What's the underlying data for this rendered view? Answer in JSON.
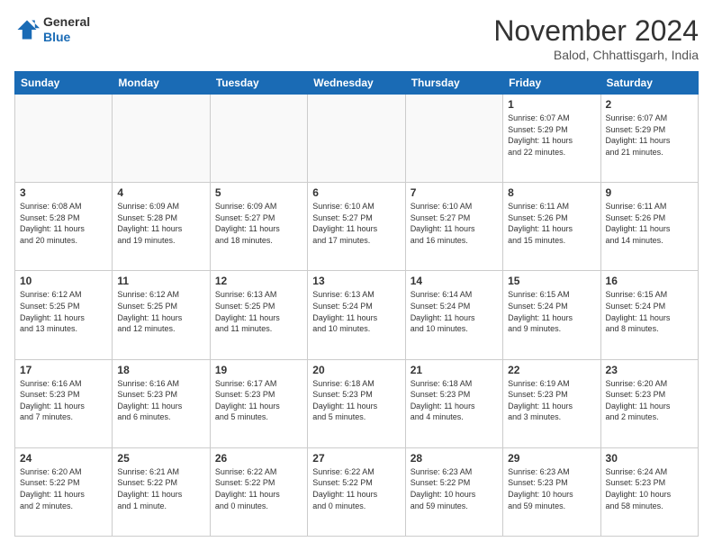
{
  "header": {
    "logo_line1": "General",
    "logo_line2": "Blue",
    "month": "November 2024",
    "location": "Balod, Chhattisgarh, India"
  },
  "days_of_week": [
    "Sunday",
    "Monday",
    "Tuesday",
    "Wednesday",
    "Thursday",
    "Friday",
    "Saturday"
  ],
  "weeks": [
    [
      {
        "day": "",
        "info": ""
      },
      {
        "day": "",
        "info": ""
      },
      {
        "day": "",
        "info": ""
      },
      {
        "day": "",
        "info": ""
      },
      {
        "day": "",
        "info": ""
      },
      {
        "day": "1",
        "info": "Sunrise: 6:07 AM\nSunset: 5:29 PM\nDaylight: 11 hours\nand 22 minutes."
      },
      {
        "day": "2",
        "info": "Sunrise: 6:07 AM\nSunset: 5:29 PM\nDaylight: 11 hours\nand 21 minutes."
      }
    ],
    [
      {
        "day": "3",
        "info": "Sunrise: 6:08 AM\nSunset: 5:28 PM\nDaylight: 11 hours\nand 20 minutes."
      },
      {
        "day": "4",
        "info": "Sunrise: 6:09 AM\nSunset: 5:28 PM\nDaylight: 11 hours\nand 19 minutes."
      },
      {
        "day": "5",
        "info": "Sunrise: 6:09 AM\nSunset: 5:27 PM\nDaylight: 11 hours\nand 18 minutes."
      },
      {
        "day": "6",
        "info": "Sunrise: 6:10 AM\nSunset: 5:27 PM\nDaylight: 11 hours\nand 17 minutes."
      },
      {
        "day": "7",
        "info": "Sunrise: 6:10 AM\nSunset: 5:27 PM\nDaylight: 11 hours\nand 16 minutes."
      },
      {
        "day": "8",
        "info": "Sunrise: 6:11 AM\nSunset: 5:26 PM\nDaylight: 11 hours\nand 15 minutes."
      },
      {
        "day": "9",
        "info": "Sunrise: 6:11 AM\nSunset: 5:26 PM\nDaylight: 11 hours\nand 14 minutes."
      }
    ],
    [
      {
        "day": "10",
        "info": "Sunrise: 6:12 AM\nSunset: 5:25 PM\nDaylight: 11 hours\nand 13 minutes."
      },
      {
        "day": "11",
        "info": "Sunrise: 6:12 AM\nSunset: 5:25 PM\nDaylight: 11 hours\nand 12 minutes."
      },
      {
        "day": "12",
        "info": "Sunrise: 6:13 AM\nSunset: 5:25 PM\nDaylight: 11 hours\nand 11 minutes."
      },
      {
        "day": "13",
        "info": "Sunrise: 6:13 AM\nSunset: 5:24 PM\nDaylight: 11 hours\nand 10 minutes."
      },
      {
        "day": "14",
        "info": "Sunrise: 6:14 AM\nSunset: 5:24 PM\nDaylight: 11 hours\nand 10 minutes."
      },
      {
        "day": "15",
        "info": "Sunrise: 6:15 AM\nSunset: 5:24 PM\nDaylight: 11 hours\nand 9 minutes."
      },
      {
        "day": "16",
        "info": "Sunrise: 6:15 AM\nSunset: 5:24 PM\nDaylight: 11 hours\nand 8 minutes."
      }
    ],
    [
      {
        "day": "17",
        "info": "Sunrise: 6:16 AM\nSunset: 5:23 PM\nDaylight: 11 hours\nand 7 minutes."
      },
      {
        "day": "18",
        "info": "Sunrise: 6:16 AM\nSunset: 5:23 PM\nDaylight: 11 hours\nand 6 minutes."
      },
      {
        "day": "19",
        "info": "Sunrise: 6:17 AM\nSunset: 5:23 PM\nDaylight: 11 hours\nand 5 minutes."
      },
      {
        "day": "20",
        "info": "Sunrise: 6:18 AM\nSunset: 5:23 PM\nDaylight: 11 hours\nand 5 minutes."
      },
      {
        "day": "21",
        "info": "Sunrise: 6:18 AM\nSunset: 5:23 PM\nDaylight: 11 hours\nand 4 minutes."
      },
      {
        "day": "22",
        "info": "Sunrise: 6:19 AM\nSunset: 5:23 PM\nDaylight: 11 hours\nand 3 minutes."
      },
      {
        "day": "23",
        "info": "Sunrise: 6:20 AM\nSunset: 5:23 PM\nDaylight: 11 hours\nand 2 minutes."
      }
    ],
    [
      {
        "day": "24",
        "info": "Sunrise: 6:20 AM\nSunset: 5:22 PM\nDaylight: 11 hours\nand 2 minutes."
      },
      {
        "day": "25",
        "info": "Sunrise: 6:21 AM\nSunset: 5:22 PM\nDaylight: 11 hours\nand 1 minute."
      },
      {
        "day": "26",
        "info": "Sunrise: 6:22 AM\nSunset: 5:22 PM\nDaylight: 11 hours\nand 0 minutes."
      },
      {
        "day": "27",
        "info": "Sunrise: 6:22 AM\nSunset: 5:22 PM\nDaylight: 11 hours\nand 0 minutes."
      },
      {
        "day": "28",
        "info": "Sunrise: 6:23 AM\nSunset: 5:22 PM\nDaylight: 10 hours\nand 59 minutes."
      },
      {
        "day": "29",
        "info": "Sunrise: 6:23 AM\nSunset: 5:23 PM\nDaylight: 10 hours\nand 59 minutes."
      },
      {
        "day": "30",
        "info": "Sunrise: 6:24 AM\nSunset: 5:23 PM\nDaylight: 10 hours\nand 58 minutes."
      }
    ]
  ]
}
